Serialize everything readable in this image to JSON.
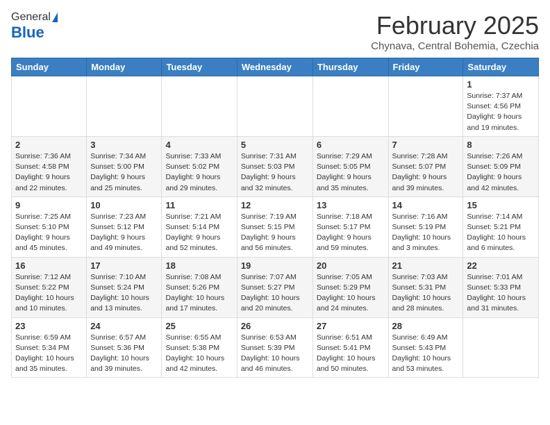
{
  "logo": {
    "general": "General",
    "blue": "Blue"
  },
  "title": "February 2025",
  "subtitle": "Chynava, Central Bohemia, Czechia",
  "days_of_week": [
    "Sunday",
    "Monday",
    "Tuesday",
    "Wednesday",
    "Thursday",
    "Friday",
    "Saturday"
  ],
  "weeks": [
    [
      {
        "day": "",
        "info": ""
      },
      {
        "day": "",
        "info": ""
      },
      {
        "day": "",
        "info": ""
      },
      {
        "day": "",
        "info": ""
      },
      {
        "day": "",
        "info": ""
      },
      {
        "day": "",
        "info": ""
      },
      {
        "day": "1",
        "info": "Sunrise: 7:37 AM\nSunset: 4:56 PM\nDaylight: 9 hours and 19 minutes."
      }
    ],
    [
      {
        "day": "2",
        "info": "Sunrise: 7:36 AM\nSunset: 4:58 PM\nDaylight: 9 hours and 22 minutes."
      },
      {
        "day": "3",
        "info": "Sunrise: 7:34 AM\nSunset: 5:00 PM\nDaylight: 9 hours and 25 minutes."
      },
      {
        "day": "4",
        "info": "Sunrise: 7:33 AM\nSunset: 5:02 PM\nDaylight: 9 hours and 29 minutes."
      },
      {
        "day": "5",
        "info": "Sunrise: 7:31 AM\nSunset: 5:03 PM\nDaylight: 9 hours and 32 minutes."
      },
      {
        "day": "6",
        "info": "Sunrise: 7:29 AM\nSunset: 5:05 PM\nDaylight: 9 hours and 35 minutes."
      },
      {
        "day": "7",
        "info": "Sunrise: 7:28 AM\nSunset: 5:07 PM\nDaylight: 9 hours and 39 minutes."
      },
      {
        "day": "8",
        "info": "Sunrise: 7:26 AM\nSunset: 5:09 PM\nDaylight: 9 hours and 42 minutes."
      }
    ],
    [
      {
        "day": "9",
        "info": "Sunrise: 7:25 AM\nSunset: 5:10 PM\nDaylight: 9 hours and 45 minutes."
      },
      {
        "day": "10",
        "info": "Sunrise: 7:23 AM\nSunset: 5:12 PM\nDaylight: 9 hours and 49 minutes."
      },
      {
        "day": "11",
        "info": "Sunrise: 7:21 AM\nSunset: 5:14 PM\nDaylight: 9 hours and 52 minutes."
      },
      {
        "day": "12",
        "info": "Sunrise: 7:19 AM\nSunset: 5:15 PM\nDaylight: 9 hours and 56 minutes."
      },
      {
        "day": "13",
        "info": "Sunrise: 7:18 AM\nSunset: 5:17 PM\nDaylight: 9 hours and 59 minutes."
      },
      {
        "day": "14",
        "info": "Sunrise: 7:16 AM\nSunset: 5:19 PM\nDaylight: 10 hours and 3 minutes."
      },
      {
        "day": "15",
        "info": "Sunrise: 7:14 AM\nSunset: 5:21 PM\nDaylight: 10 hours and 6 minutes."
      }
    ],
    [
      {
        "day": "16",
        "info": "Sunrise: 7:12 AM\nSunset: 5:22 PM\nDaylight: 10 hours and 10 minutes."
      },
      {
        "day": "17",
        "info": "Sunrise: 7:10 AM\nSunset: 5:24 PM\nDaylight: 10 hours and 13 minutes."
      },
      {
        "day": "18",
        "info": "Sunrise: 7:08 AM\nSunset: 5:26 PM\nDaylight: 10 hours and 17 minutes."
      },
      {
        "day": "19",
        "info": "Sunrise: 7:07 AM\nSunset: 5:27 PM\nDaylight: 10 hours and 20 minutes."
      },
      {
        "day": "20",
        "info": "Sunrise: 7:05 AM\nSunset: 5:29 PM\nDaylight: 10 hours and 24 minutes."
      },
      {
        "day": "21",
        "info": "Sunrise: 7:03 AM\nSunset: 5:31 PM\nDaylight: 10 hours and 28 minutes."
      },
      {
        "day": "22",
        "info": "Sunrise: 7:01 AM\nSunset: 5:33 PM\nDaylight: 10 hours and 31 minutes."
      }
    ],
    [
      {
        "day": "23",
        "info": "Sunrise: 6:59 AM\nSunset: 5:34 PM\nDaylight: 10 hours and 35 minutes."
      },
      {
        "day": "24",
        "info": "Sunrise: 6:57 AM\nSunset: 5:36 PM\nDaylight: 10 hours and 39 minutes."
      },
      {
        "day": "25",
        "info": "Sunrise: 6:55 AM\nSunset: 5:38 PM\nDaylight: 10 hours and 42 minutes."
      },
      {
        "day": "26",
        "info": "Sunrise: 6:53 AM\nSunset: 5:39 PM\nDaylight: 10 hours and 46 minutes."
      },
      {
        "day": "27",
        "info": "Sunrise: 6:51 AM\nSunset: 5:41 PM\nDaylight: 10 hours and 50 minutes."
      },
      {
        "day": "28",
        "info": "Sunrise: 6:49 AM\nSunset: 5:43 PM\nDaylight: 10 hours and 53 minutes."
      },
      {
        "day": "",
        "info": ""
      }
    ]
  ]
}
